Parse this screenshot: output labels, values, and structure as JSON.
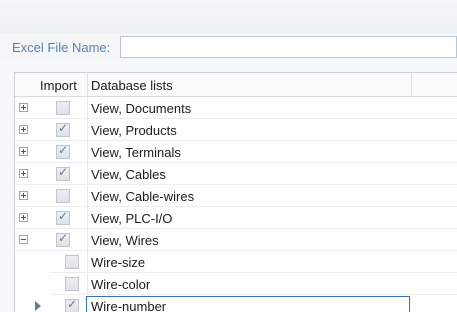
{
  "form": {
    "excel_file_label": "Excel File Name:",
    "excel_file_value": ""
  },
  "grid": {
    "columns": [
      "Import",
      "Database lists"
    ],
    "parents": [
      {
        "label": "View, Documents",
        "checked": false,
        "expanded": false
      },
      {
        "label": "View, Products",
        "checked": true,
        "expanded": false
      },
      {
        "label": "View, Terminals",
        "checked": true,
        "expanded": false
      },
      {
        "label": "View, Cables",
        "checked": true,
        "expanded": false
      },
      {
        "label": "View, Cable-wires",
        "checked": false,
        "expanded": false
      },
      {
        "label": "View, PLC-I/O",
        "checked": true,
        "expanded": false
      },
      {
        "label": "View, Wires",
        "checked": true,
        "expanded": true
      }
    ],
    "children": [
      {
        "label": "Wire-size",
        "checked": false
      },
      {
        "label": "Wire-color",
        "checked": false
      },
      {
        "label": "Wire-number",
        "checked": true,
        "current": true
      }
    ]
  },
  "icons": {
    "expand": "plus-box-icon",
    "collapse": "minus-box-icon",
    "check": "checkmark-icon",
    "row_pointer": "triangle-right-icon"
  }
}
